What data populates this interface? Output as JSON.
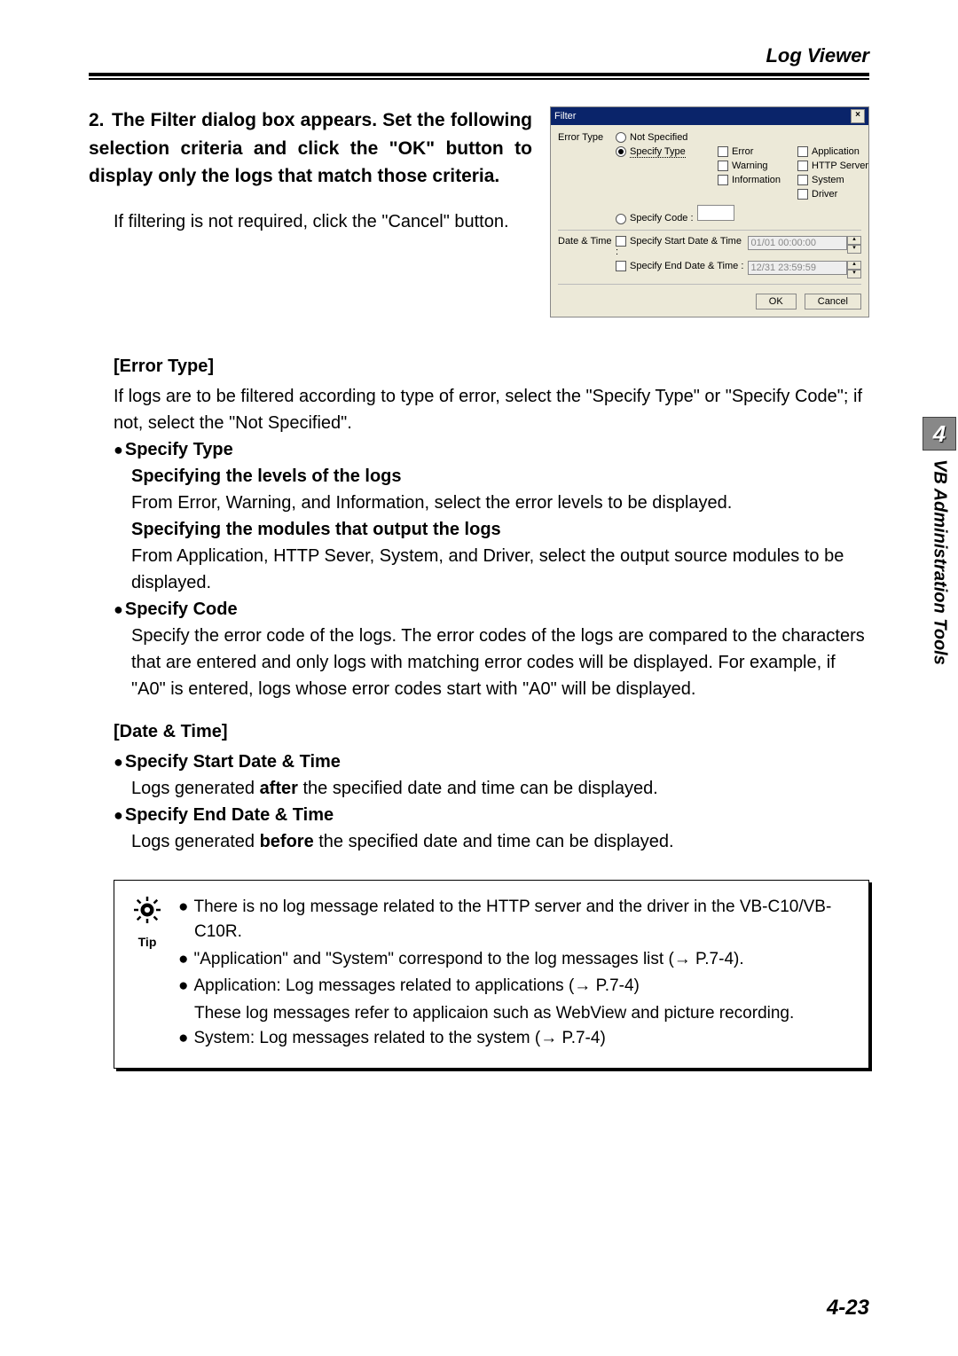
{
  "header": {
    "title": "Log Viewer"
  },
  "step": {
    "number": "2.",
    "heading": "The Filter dialog box appears. Set the following selection criteria and click the \"OK\" button to display only the logs that match those criteria.",
    "sub": "If filtering is not required, click the \"Cancel\" button."
  },
  "dialog": {
    "title": "Filter",
    "error_type_label": "Error Type",
    "radio_not_specified": "Not Specified",
    "radio_specify_type": "Specify Type",
    "radio_specify_code": "Specify Code :",
    "chk_error": "Error",
    "chk_warning": "Warning",
    "chk_information": "Information",
    "chk_application": "Application",
    "chk_http": "HTTP Server",
    "chk_system": "System",
    "chk_driver": "Driver",
    "date_time_label": "Date & Time",
    "chk_start": "Specify Start Date & Time :",
    "chk_end": "Specify End Date & Time :",
    "start_value": "01/01 00:00:00",
    "end_value": "12/31 23:59:59",
    "ok": "OK",
    "cancel": "Cancel"
  },
  "body": {
    "error_type_heading": "[Error Type]",
    "error_type_intro": "If logs are to be filtered according to type of error, select the \"Specify Type\" or \"Specify Code\"; if not, select the \"Not Specified\".",
    "specify_type_label": "Specify Type",
    "levels_heading": "Specifying the levels of the logs",
    "levels_text": "From Error, Warning, and Information, select the error levels to be displayed.",
    "modules_heading": "Specifying the modules that output the logs",
    "modules_text": "From Application, HTTP Sever, System, and Driver, select the output source modules to be displayed.",
    "specify_code_label": "Specify Code",
    "specify_code_text": "Specify the error code of the logs. The error codes of the logs are compared to the characters that are entered and only logs with matching error codes will be displayed. For example, if \"A0\" is entered, logs whose error codes start with \"A0\" will be displayed.",
    "date_time_heading": "[Date & Time]",
    "start_label": "Specify Start Date & Time",
    "start_text_pre": "Logs generated ",
    "start_text_bold": "after",
    "start_text_post": " the specified date and time can be displayed.",
    "end_label": "Specify End Date & Time",
    "end_text_pre": "Logs generated ",
    "end_text_bold": "before",
    "end_text_post": " the specified date and time can be displayed."
  },
  "tip": {
    "label": "Tip",
    "items": [
      "There is no log message related to the HTTP server and the driver in the VB-C10/VB-C10R.",
      "\"Application\" and \"System\" correspond to the log messages list (→ P.7-4).",
      "Application: Log messages related to applications (→ P.7-4)",
      "System: Log messages related to the system (→ P.7-4)"
    ],
    "sub": "These log messages refer to applicaion such as WebView and picture recording."
  },
  "side": {
    "number": "4",
    "text": "VB Administration Tools"
  },
  "page_number": "4-23"
}
